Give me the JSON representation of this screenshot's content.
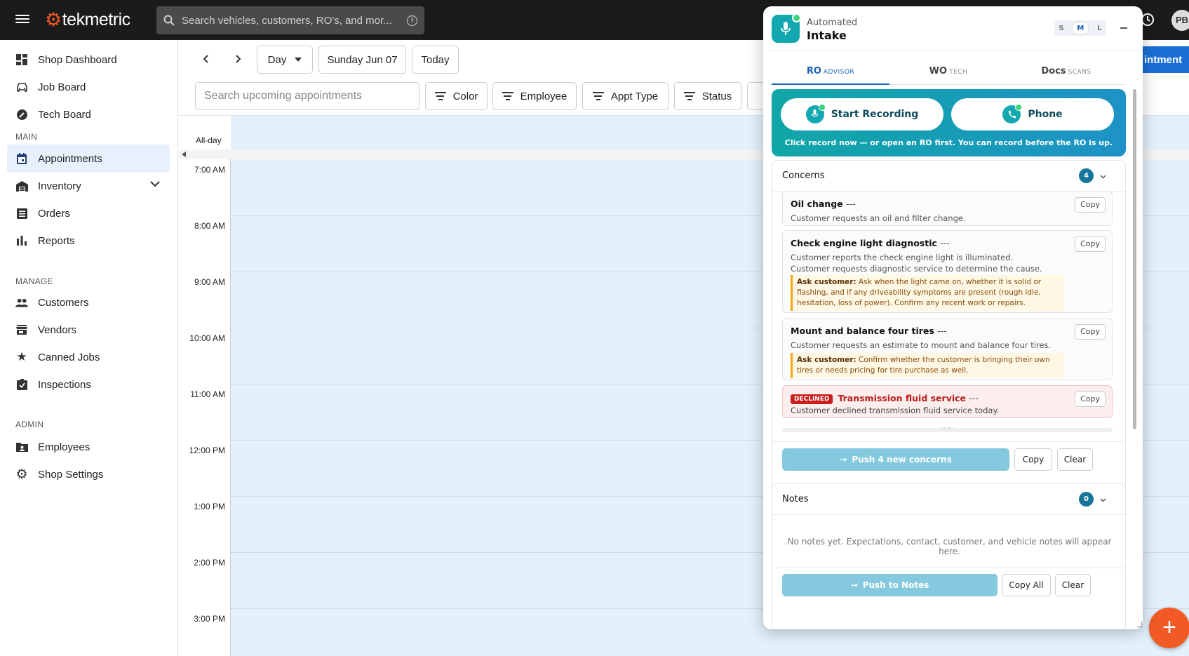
{
  "topbar": {
    "brand": "tekmetric",
    "search_placeholder": "Search vehicles, customers, RO's, and mor...",
    "avatar_initials": "PB"
  },
  "sidebar": {
    "items": [
      {
        "label": "Shop Dashboard",
        "icon": "dashboard-icon"
      },
      {
        "label": "Job Board",
        "icon": "car-icon"
      },
      {
        "label": "Tech Board",
        "icon": "gauge-icon"
      },
      {
        "label": "Appointments",
        "icon": "calendar-icon",
        "active": true
      },
      {
        "label": "Inventory",
        "icon": "warehouse-icon",
        "expandable": true
      },
      {
        "label": "Orders",
        "icon": "list-icon"
      },
      {
        "label": "Reports",
        "icon": "bar-chart-icon"
      },
      {
        "label": "Customers",
        "icon": "people-icon"
      },
      {
        "label": "Vendors",
        "icon": "store-icon"
      },
      {
        "label": "Canned Jobs",
        "icon": "star-icon"
      },
      {
        "label": "Inspections",
        "icon": "clipboard-icon"
      },
      {
        "label": "Employees",
        "icon": "badge-folder-icon"
      },
      {
        "label": "Shop Settings",
        "icon": "gear-icon"
      }
    ],
    "headings": {
      "main": "MAIN",
      "manage": "MANAGE",
      "admin": "ADMIN"
    }
  },
  "toolbar": {
    "view": "Day",
    "date": "Sunday Jun 07",
    "today": "Today",
    "search_placeholder": "Search upcoming appointments",
    "filters": [
      "Color",
      "Employee",
      "Appt Type",
      "Status"
    ],
    "new_appt_partial": "intment"
  },
  "calendar": {
    "allday_label": "All-day",
    "times": [
      "7:00 AM",
      "8:00 AM",
      "9:00 AM",
      "10:00 AM",
      "11:00 AM",
      "12:00 PM",
      "1:00 PM",
      "2:00 PM",
      "3:00 PM"
    ]
  },
  "panel": {
    "title_small": "Automated",
    "title": "Intake",
    "sizes": [
      "S",
      "M",
      "L"
    ],
    "selected_size": "M",
    "tabs": [
      {
        "label": "RO",
        "sub": "ADVISOR"
      },
      {
        "label": "WO",
        "sub": "TECH"
      },
      {
        "label": "Docs",
        "sub": "SCANS"
      }
    ],
    "record": {
      "start_label": "Start Recording",
      "phone_label": "Phone",
      "hint": "Click record now — or open an RO first. You can record before the RO is up."
    },
    "concerns": {
      "title": "Concerns",
      "count": "4",
      "items": [
        {
          "title": "Oil change",
          "dash": "---",
          "desc": "Customer requests an oil and filter change.",
          "copy": "Copy"
        },
        {
          "title": "Check engine light diagnostic",
          "dash": "---",
          "desc": "Customer reports the check engine light is illuminated. Customer requests diagnostic service to determine the cause.",
          "ask_label": "Ask customer:",
          "ask": "Ask when the light came on, whether it is solid or flashing, and if any driveability symptoms are present (rough idle, hesitation, loss of power). Confirm any recent work or repairs.",
          "copy": "Copy"
        },
        {
          "title": "Mount and balance four tires",
          "dash": "---",
          "desc": "Customer requests an estimate to mount and balance four tires.",
          "ask_label": "Ask customer:",
          "ask": "Confirm whether the customer is bringing their own tires or needs pricing for tire purchase as well.",
          "copy": "Copy"
        },
        {
          "badge": "DECLINED",
          "title": "Transmission fluid service",
          "dash": "---",
          "desc": "Customer declined transmission fluid service today.",
          "copy": "Copy"
        }
      ],
      "push_label": "Push 4 new concerns",
      "copy_label": "Copy",
      "clear_label": "Clear"
    },
    "notes": {
      "title": "Notes",
      "count": "0",
      "empty": "No notes yet. Expectations, contact, customer, and vehicle notes will appear here.",
      "push_label": "Push to Notes",
      "copy_label": "Copy All",
      "clear_label": "Clear"
    }
  },
  "colors": {
    "brand_orange": "#f15a24",
    "accent_blue": "#1a5fb4",
    "teal": "#13a7b0",
    "calendar_fill": "#e3f1fc",
    "declined_red": "#c81e1e"
  }
}
